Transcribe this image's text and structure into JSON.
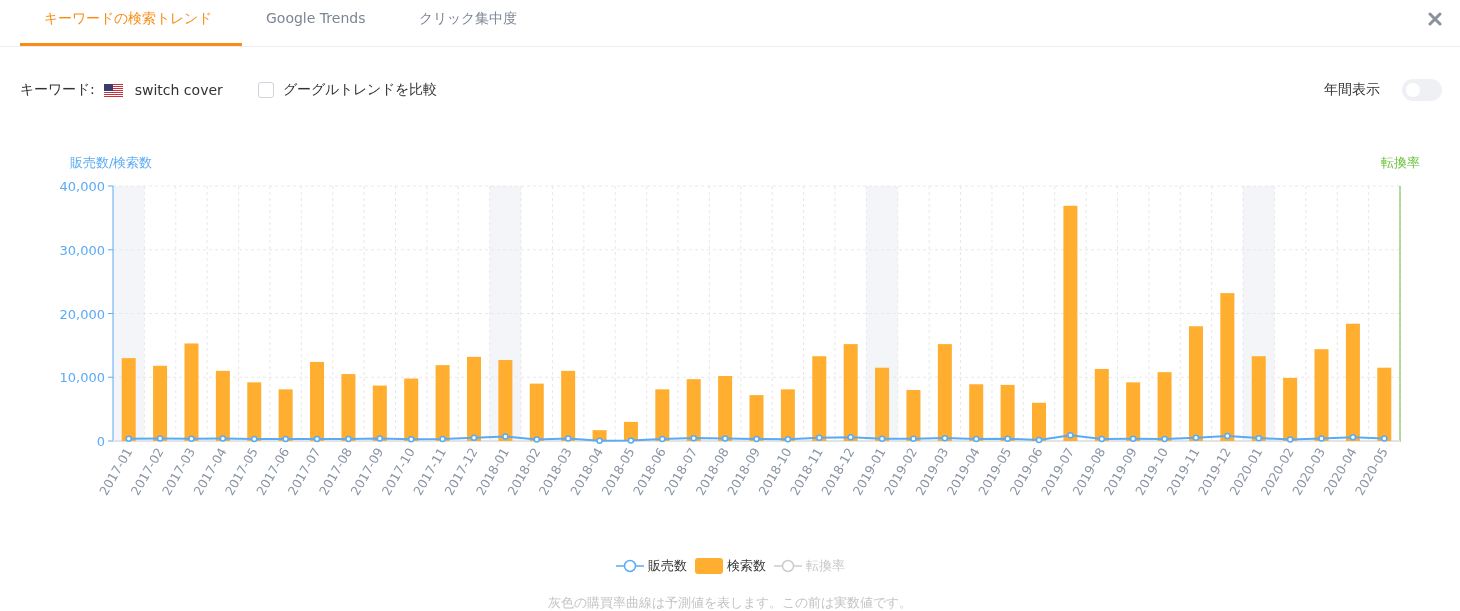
{
  "tabs": [
    {
      "label": "キーワードの検索トレンド",
      "selected": true
    },
    {
      "label": "Google Trends",
      "selected": false
    },
    {
      "label": "クリック集中度",
      "selected": false
    }
  ],
  "keyword": {
    "label": "キーワード:",
    "value": "switch cover"
  },
  "compare": {
    "label": "グーグルトレンドを比較",
    "checked": false
  },
  "annual": {
    "label": "年間表示",
    "on": false
  },
  "chart": {
    "left_axis_title": "販売数/検索数",
    "right_axis_title": "転換率",
    "chart_data": {
      "type": "bar",
      "stacked": false,
      "grid": true,
      "ylim": [
        0,
        40000
      ],
      "yticks": [
        {
          "value": 0,
          "label": "0"
        },
        {
          "value": 10000,
          "label": "10,000"
        },
        {
          "value": 20000,
          "label": "20,000"
        },
        {
          "value": 30000,
          "label": "30,000"
        },
        {
          "value": 40000,
          "label": "40,000"
        }
      ],
      "categories": [
        "2017-01",
        "2017-02",
        "2017-03",
        "2017-04",
        "2017-05",
        "2017-06",
        "2017-07",
        "2017-08",
        "2017-09",
        "2017-10",
        "2017-11",
        "2017-12",
        "2018-01",
        "2018-02",
        "2018-03",
        "2018-04",
        "2018-05",
        "2018-06",
        "2018-07",
        "2018-08",
        "2018-09",
        "2018-10",
        "2018-11",
        "2018-12",
        "2019-01",
        "2019-02",
        "2019-03",
        "2019-04",
        "2019-05",
        "2019-06",
        "2019-07",
        "2019-08",
        "2019-09",
        "2019-10",
        "2019-11",
        "2019-12",
        "2020-01",
        "2020-02",
        "2020-03",
        "2020-04",
        "2020-05"
      ],
      "series": [
        {
          "name": "販売数",
          "type": "line",
          "marker": "circle",
          "color": "#5aabf5",
          "values": [
            350,
            380,
            350,
            380,
            330,
            300,
            320,
            310,
            380,
            280,
            320,
            500,
            700,
            250,
            400,
            50,
            80,
            330,
            450,
            380,
            320,
            280,
            500,
            600,
            350,
            350,
            450,
            300,
            350,
            150,
            900,
            330,
            350,
            330,
            500,
            800,
            450,
            250,
            400,
            600,
            400
          ]
        },
        {
          "name": "検索数",
          "type": "bar",
          "color": "#ffae2f",
          "values": [
            13000,
            11800,
            15300,
            11000,
            9200,
            8100,
            12400,
            10500,
            8700,
            9800,
            11900,
            13200,
            12700,
            9000,
            11000,
            1700,
            3000,
            8100,
            9700,
            10200,
            7200,
            8100,
            13300,
            15200,
            11500,
            8000,
            15200,
            8900,
            8800,
            6000,
            36900,
            11300,
            9200,
            10800,
            18000,
            23200,
            13300,
            9900,
            14400,
            18400,
            11500
          ]
        }
      ]
    }
  },
  "legend": [
    {
      "selected": true
    },
    {
      "selected": true
    },
    {
      "label": "転換率",
      "kind": "line",
      "selected": false
    }
  ],
  "footnote": "灰色の購買率曲線は予測値を表します。この前は実数値です。"
}
